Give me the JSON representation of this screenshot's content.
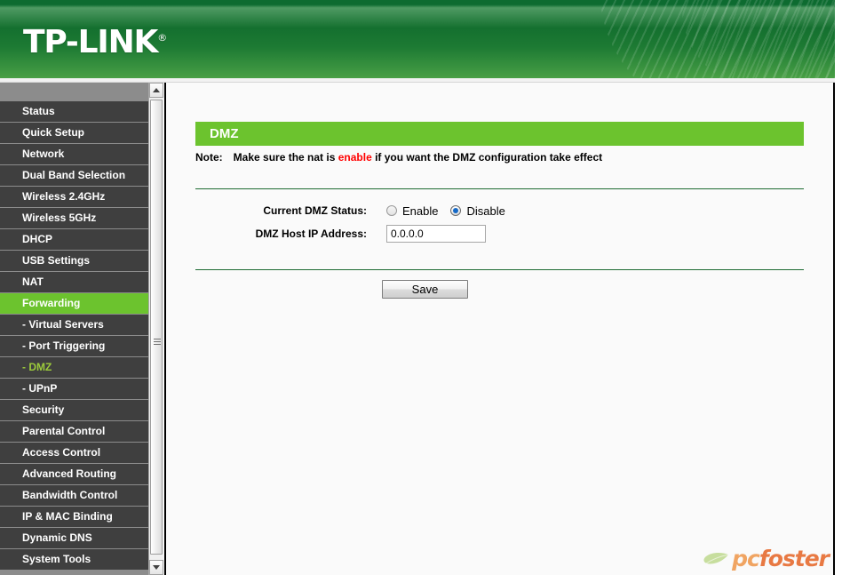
{
  "header": {
    "brand": "TP-LINK",
    "registered_mark": "®"
  },
  "sidebar": {
    "items": [
      {
        "label": "Status",
        "state": "normal"
      },
      {
        "label": "Quick Setup",
        "state": "normal"
      },
      {
        "label": "Network",
        "state": "normal"
      },
      {
        "label": "Dual Band Selection",
        "state": "normal"
      },
      {
        "label": "Wireless 2.4GHz",
        "state": "normal"
      },
      {
        "label": "Wireless 5GHz",
        "state": "normal"
      },
      {
        "label": "DHCP",
        "state": "normal"
      },
      {
        "label": "USB Settings",
        "state": "normal"
      },
      {
        "label": "NAT",
        "state": "normal"
      },
      {
        "label": "Forwarding",
        "state": "active-parent"
      },
      {
        "label": "- Virtual Servers",
        "state": "sub"
      },
      {
        "label": "- Port Triggering",
        "state": "sub"
      },
      {
        "label": "- DMZ",
        "state": "active-sub"
      },
      {
        "label": "- UPnP",
        "state": "sub"
      },
      {
        "label": "Security",
        "state": "normal"
      },
      {
        "label": "Parental Control",
        "state": "normal"
      },
      {
        "label": "Access Control",
        "state": "normal"
      },
      {
        "label": "Advanced Routing",
        "state": "normal"
      },
      {
        "label": "Bandwidth Control",
        "state": "normal"
      },
      {
        "label": "IP & MAC Binding",
        "state": "normal"
      },
      {
        "label": "Dynamic DNS",
        "state": "normal"
      },
      {
        "label": "System Tools",
        "state": "normal"
      }
    ]
  },
  "main": {
    "page_title": "DMZ",
    "note": {
      "label": "Note:",
      "text_before": "Make sure the nat is",
      "highlight": "enable",
      "text_after": "if you want the DMZ configuration take effect"
    },
    "fields": {
      "status_label": "Current DMZ Status:",
      "status_options": [
        {
          "label": "Enable",
          "checked": false
        },
        {
          "label": "Disable",
          "checked": true
        }
      ],
      "ip_label": "DMZ Host IP Address:",
      "ip_value": "0.0.0.0"
    },
    "save_label": "Save"
  },
  "watermark": {
    "text_part1": "pc",
    "text_part2": "foster"
  },
  "colors": {
    "brand_green": "#6cc32e",
    "header_dark_green": "#0d6b30",
    "sidebar_item": "#3f3f3f",
    "sidebar_separator": "#8c8c8c",
    "active_sub_text": "#9ccb3b",
    "note_highlight": "#ff0000",
    "rule_green": "#1d6b32",
    "radio_checked": "#1569c7"
  }
}
